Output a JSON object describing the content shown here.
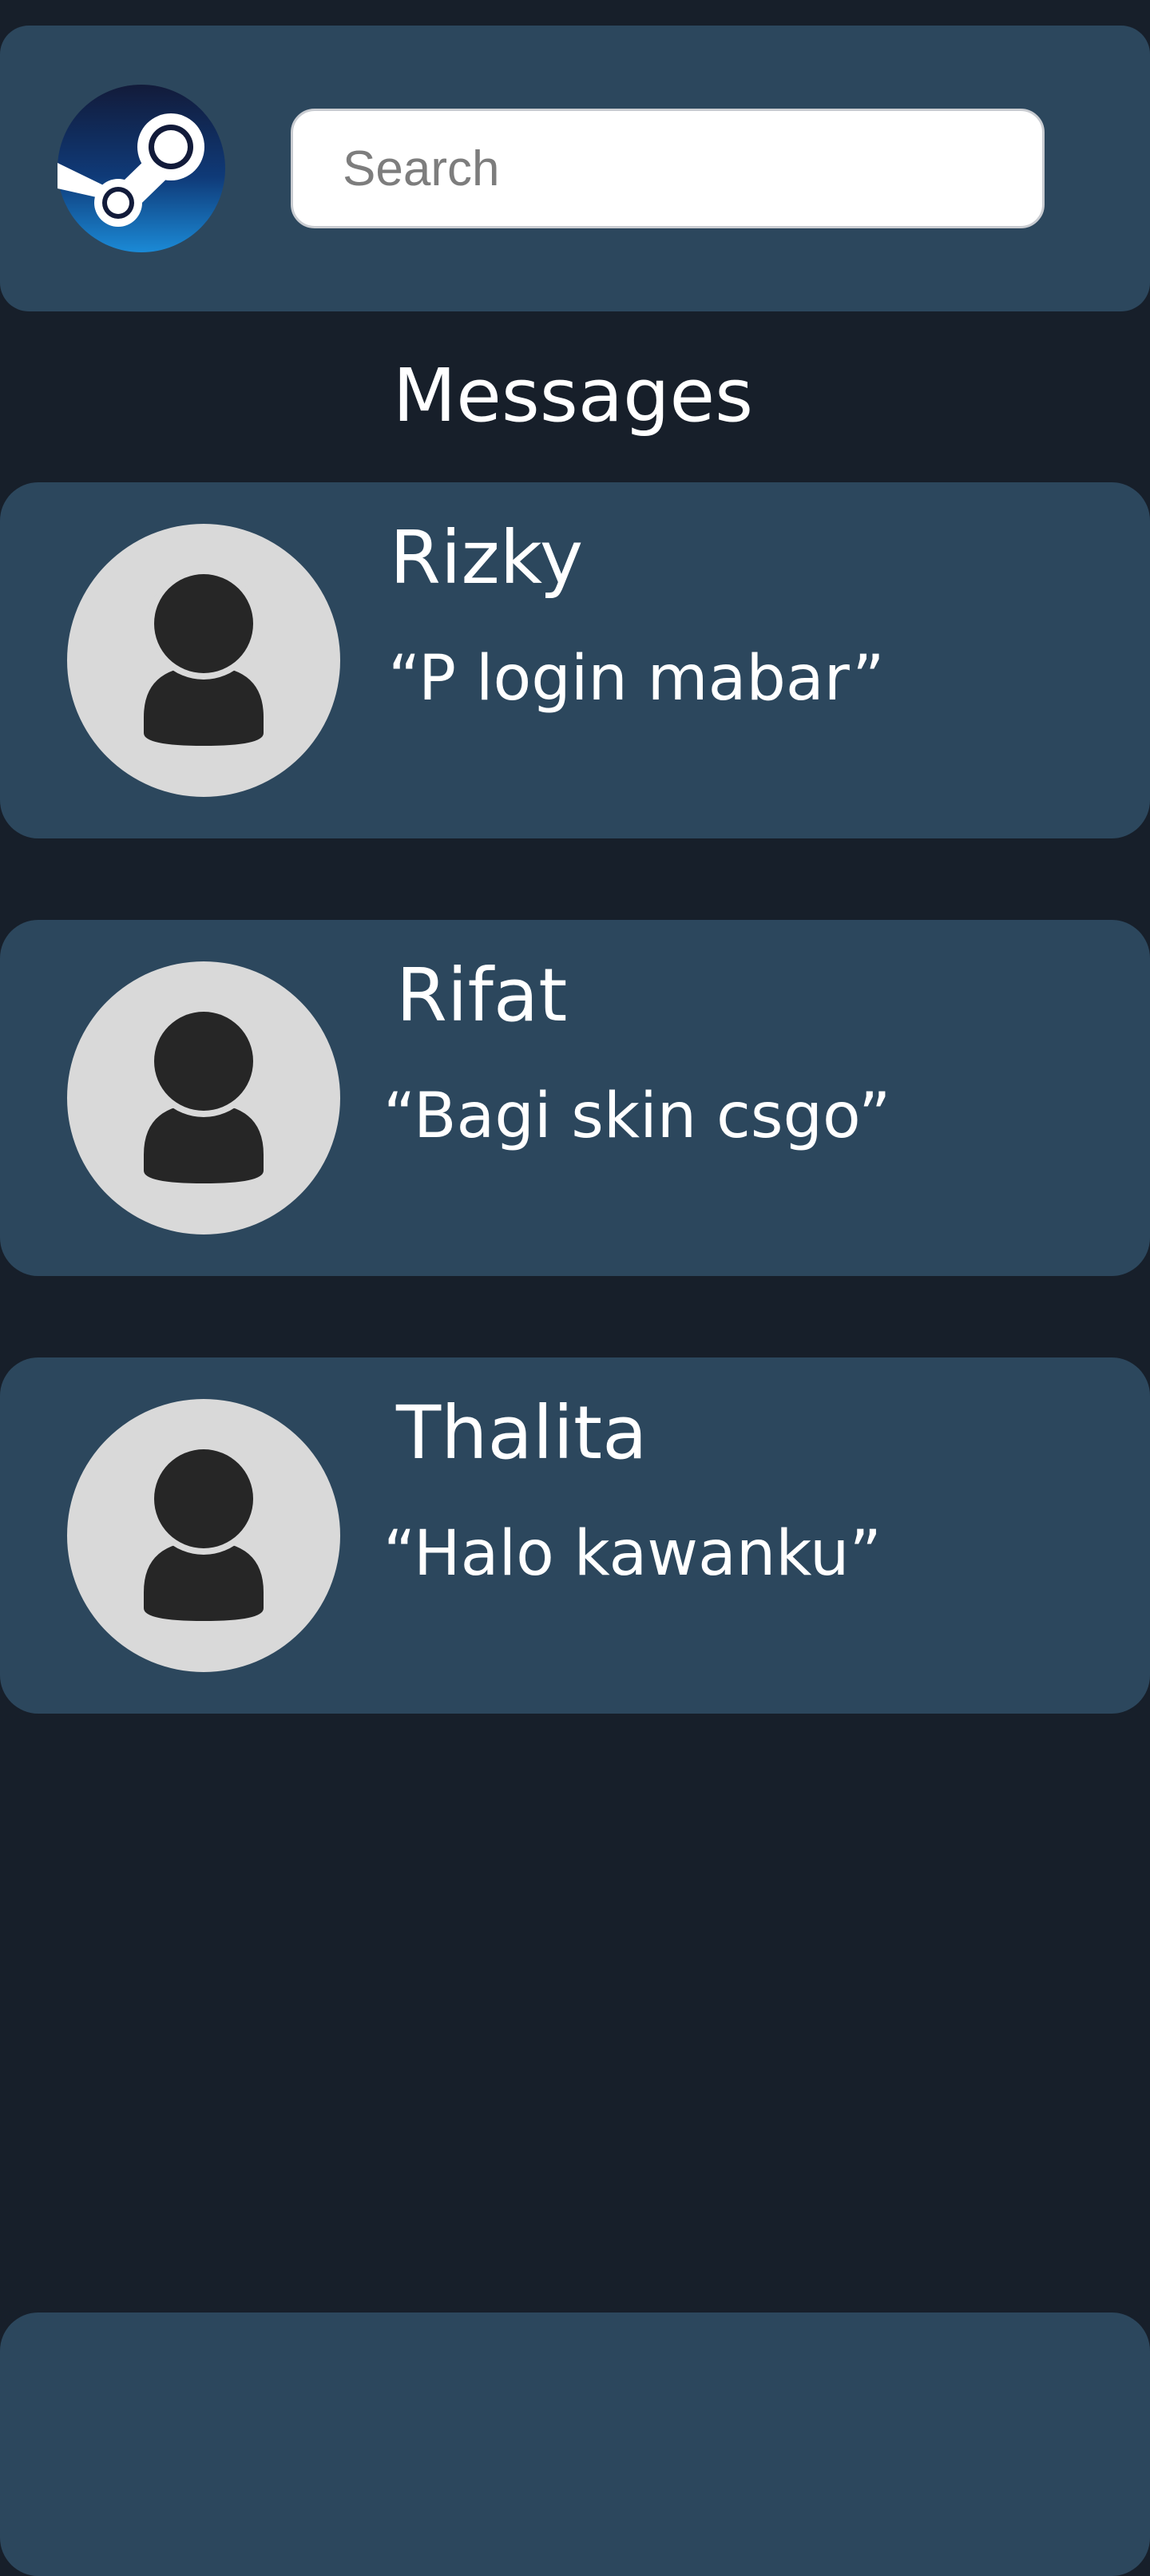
{
  "header": {
    "logo": "steam-logo-icon",
    "search_placeholder": "Search"
  },
  "page_title": "Messages",
  "conversations": [
    {
      "name": "Rizky",
      "message": "“P login mabar”",
      "avatar": "person-icon"
    },
    {
      "name": "Rifat",
      "message": "“Bagi skin csgo”",
      "avatar": "person-icon"
    },
    {
      "name": "Thalita",
      "message": "“Halo kawanku”",
      "avatar": "person-icon"
    }
  ],
  "colors": {
    "background": "#171f2a",
    "panel": "#2c475d",
    "text": "#ffffff",
    "avatar_bg": "#d9d9d9",
    "avatar_fg": "#262626"
  }
}
